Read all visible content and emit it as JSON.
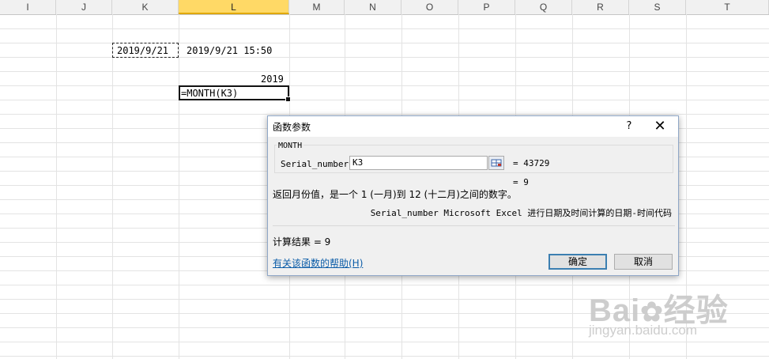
{
  "columns": [
    "I",
    "J",
    "K",
    "L",
    "M",
    "N",
    "O",
    "P",
    "Q",
    "R",
    "S",
    "T"
  ],
  "selected_column": "L",
  "cells": {
    "k1": "2019/9/21",
    "l1": "2019/9/21 15:50",
    "l3": "2019",
    "l4": "=MONTH(K3)"
  },
  "dialog": {
    "title": "函数参数",
    "help": "?",
    "close": "✕",
    "function_name": "MONTH",
    "arg_label": "Serial_number",
    "arg_input": "K3",
    "arg_value": "= 43729",
    "result_inline": "= 9",
    "description": "返回月份值，是一个 1 (一月)到 12 (十二月)之间的数字。",
    "param_description": "Serial_number Microsoft Excel 进行日期及时间计算的日期-时间代码",
    "calc_result": "计算结果 = 9",
    "help_link": "有关该函数的帮助(H)",
    "ok": "确定",
    "cancel": "取消"
  },
  "watermark": {
    "logo": "Bai●经验",
    "url": "jingyan.baidu.com"
  }
}
